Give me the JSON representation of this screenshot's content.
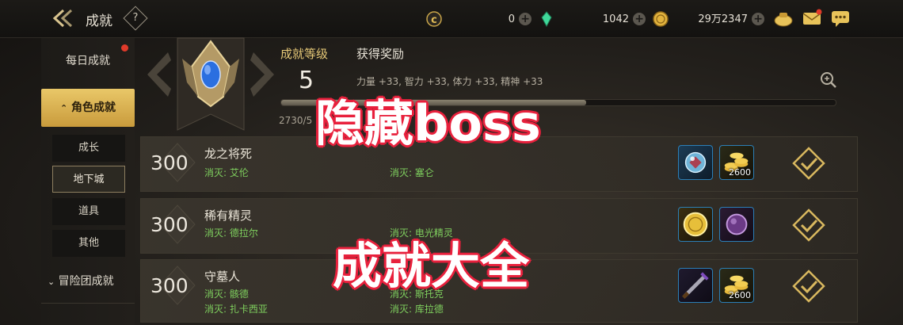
{
  "header": {
    "title": "成就",
    "help_glyph": "?",
    "currencies": [
      {
        "name": "c-coin",
        "value": "0"
      },
      {
        "name": "green-crystal",
        "value": "1042"
      },
      {
        "name": "gold-coin",
        "value": "29万2347"
      }
    ],
    "icons": [
      "back-arrow-icon",
      "help-icon",
      "bag-icon",
      "mail-icon",
      "chat-icon"
    ]
  },
  "sidebar": {
    "daily": "每日成就",
    "character": "角色成就",
    "sub_items": [
      "成长",
      "地下城",
      "道具",
      "其他"
    ],
    "selected_sub": "地下城",
    "adventure": "冒险团成就"
  },
  "summary": {
    "level_label": "成就等级",
    "level_value": "5",
    "reward_label": "获得奖励",
    "reward_stats": "力量 +33, 智力 +33, 体力 +33, 精神 +33",
    "progress_text": "2730/5",
    "progress_fraction": 0.55
  },
  "achievements": [
    {
      "points": "300",
      "name": "龙之将死",
      "conditions": [
        "消灭: 艾伦",
        "消灭: 塞仑"
      ],
      "rewards": [
        {
          "icon": "orb-icon",
          "qty": ""
        },
        {
          "icon": "gold-coins-icon",
          "qty": "2600"
        }
      ]
    },
    {
      "points": "300",
      "name": "稀有精灵",
      "conditions": [
        "消灭: 德拉尔",
        "消灭: 电光精灵"
      ],
      "rewards": [
        {
          "icon": "gold-medal-icon",
          "qty": ""
        },
        {
          "icon": "purple-gem-icon",
          "qty": ""
        }
      ]
    },
    {
      "points": "300",
      "name": "守墓人",
      "conditions": [
        "消灭: 骸德",
        "消灭: 斯托克",
        "消灭: 扎卡西亚",
        "消灭: 库拉德"
      ],
      "rewards": [
        {
          "icon": "weapon-icon",
          "qty": ""
        },
        {
          "icon": "gold-coins-icon",
          "qty": "2600"
        }
      ]
    }
  ],
  "overlay": {
    "line1": "隐藏boss",
    "line2": "成就大全"
  },
  "colors": {
    "accent_gold": "#e5c877",
    "condition_green": "#7fd05e",
    "overlay_red": "#e8203c"
  }
}
